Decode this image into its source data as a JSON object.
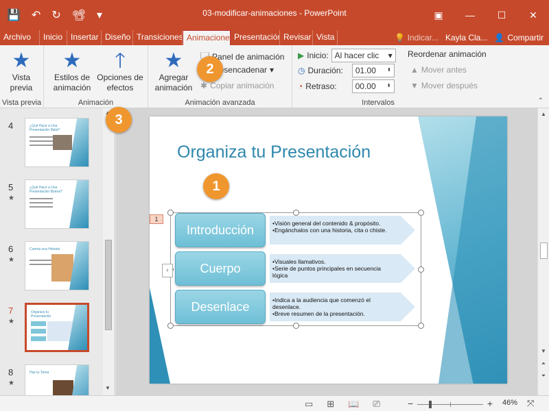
{
  "window": {
    "title": "03-modificar-animaciones - PowerPoint",
    "controls": [
      "▣",
      "—",
      "☐",
      "✕"
    ]
  },
  "qat": {
    "save_icon": "💾",
    "undo_icon": "↶",
    "redo_icon": "↻",
    "present_icon": "📽",
    "more_icon": "▾"
  },
  "tabs": [
    {
      "label": "Archivo",
      "active": false
    },
    {
      "label": "Inicio",
      "active": false
    },
    {
      "label": "Insertar",
      "active": false
    },
    {
      "label": "Diseño",
      "active": false
    },
    {
      "label": "Transiciones",
      "active": false
    },
    {
      "label": "Animaciones",
      "active": true
    },
    {
      "label": "Presentación",
      "active": false
    },
    {
      "label": "Revisar",
      "active": false
    },
    {
      "label": "Vista",
      "active": false
    }
  ],
  "tabs_right": {
    "tell_me": "Indicar...",
    "user": "Kayla Cla...",
    "share": "Compartir"
  },
  "ribbon": {
    "preview": {
      "button": "Vista previa",
      "group": "Vista previa"
    },
    "animation": {
      "styles_button": "Estilos de animación",
      "options_button": "Opciones de efectos",
      "group": "Animación"
    },
    "advanced": {
      "add_button": "Agregar animación",
      "panel": "Panel de animación",
      "trigger": "Desencadenar",
      "copy": "Copiar animación",
      "group": "Animación avanzada"
    },
    "timing": {
      "start_label": "Inicio:",
      "start_value": "Al hacer clic",
      "duration_label": "Duración:",
      "duration_value": "01.00",
      "delay_label": "Retraso:",
      "delay_value": "00.00",
      "reorder_label": "Reordenar animación",
      "move_earlier": "Mover antes",
      "move_later": "Mover después",
      "group": "Intervalos"
    }
  },
  "badges": {
    "b1": "1",
    "b2": "2",
    "b3": "3"
  },
  "thumbnails": [
    {
      "num": "4",
      "star": "",
      "title": "¿Qué Hace a Una Presentación Mala?",
      "selected": false
    },
    {
      "num": "5",
      "star": "★",
      "title": "¿Qué Hace a Una Presentación Buena?",
      "selected": false
    },
    {
      "num": "6",
      "star": "★",
      "title": "Cuenta una Historia",
      "selected": false
    },
    {
      "num": "7",
      "star": "★",
      "title": "Organiza tu Presentación",
      "selected": true
    },
    {
      "num": "8",
      "star": "★",
      "title": "Haz tu Tarea",
      "selected": false
    }
  ],
  "slide": {
    "title": "Organiza tu Presentación",
    "anim_tag": "1",
    "rows": [
      {
        "label": "Introducción",
        "text": "•Visión general del contenido & propósito.\n•Engánchalos con una historia, cita o chiste."
      },
      {
        "label": "Cuerpo",
        "text": "•Visuales llamativos.\n•Serie de puntos principales en secuencia lógica"
      },
      {
        "label": "Desenlace",
        "text": "•Indica a la audiencia que comenzó el desenlace.\n•Breve resumen de la presentación."
      }
    ]
  },
  "status": {
    "zoom": "46%",
    "zoom_level_percent": 46
  }
}
